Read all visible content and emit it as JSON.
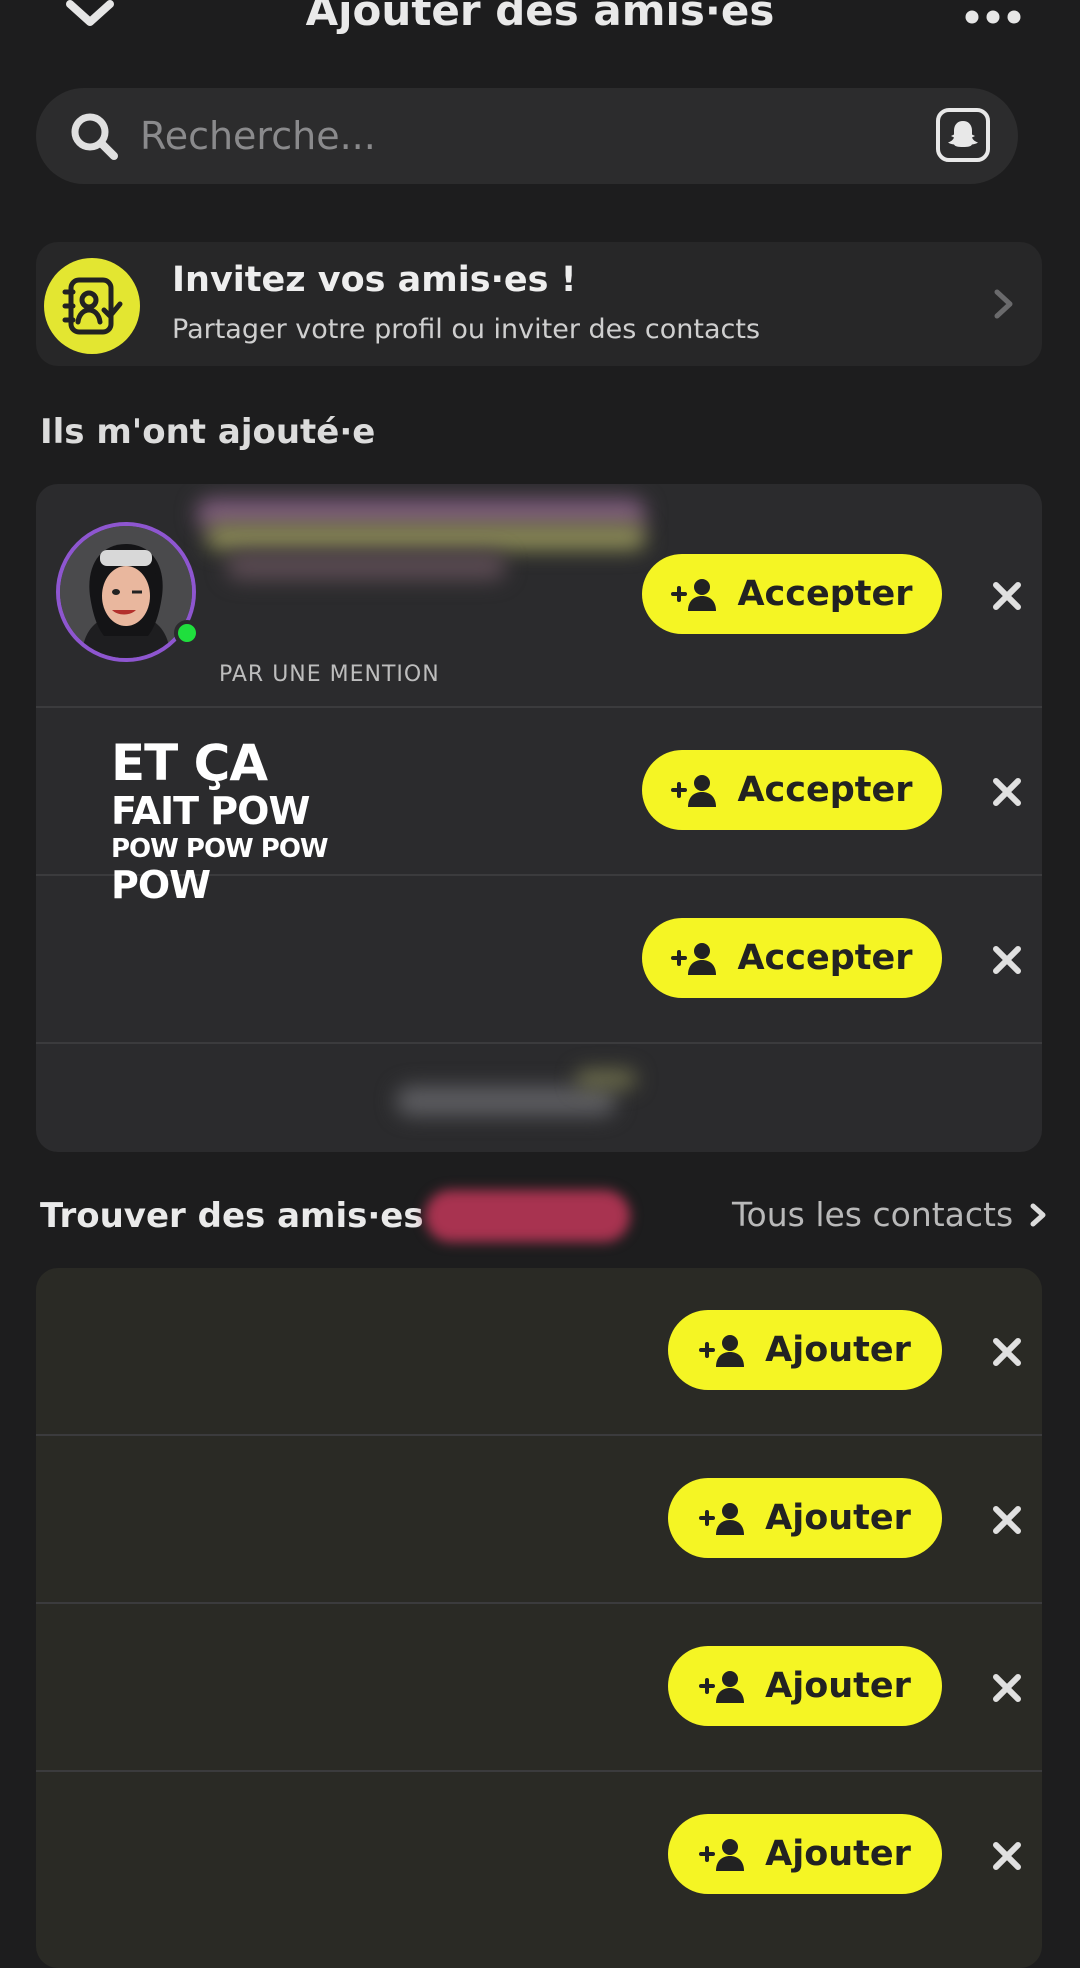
{
  "header": {
    "title": "Ajouter des amis·es",
    "back_icon": "chevron-down-icon",
    "more_icon": "more-dots-icon"
  },
  "search": {
    "placeholder": "Recherche...",
    "value": "",
    "icon": "search-icon",
    "right_icon": "snapcode-icon"
  },
  "invite": {
    "title": "Invitez vos amis·es !",
    "subtitle": "Partager votre profil ou inviter des contacts",
    "icon": "contacts-book-icon"
  },
  "added_me": {
    "title": "Ils m'ont ajouté·e",
    "rows": [
      {
        "note": "PAR UNE MENTION",
        "button_label": "Accepter"
      },
      {
        "button_label": "Accepter"
      },
      {
        "button_label": "Accepter"
      }
    ]
  },
  "sticker": {
    "line1": "ET ÇA",
    "line2": "FAIT POW",
    "line3": "POW POW POW",
    "line4": "POW"
  },
  "find_friends": {
    "title": "Trouver des amis·es",
    "all_contacts_label": "Tous les contacts",
    "rows": [
      {
        "button_label": "Ajouter"
      },
      {
        "button_label": "Ajouter"
      },
      {
        "button_label": "Ajouter"
      },
      {
        "button_label": "Ajouter"
      }
    ]
  },
  "colors": {
    "background": "#1d1d1e",
    "accent_yellow": "#f5f524",
    "card": "#2b2b2d",
    "online": "#1fdf3d",
    "avatar_ring": "#8e56d0"
  }
}
